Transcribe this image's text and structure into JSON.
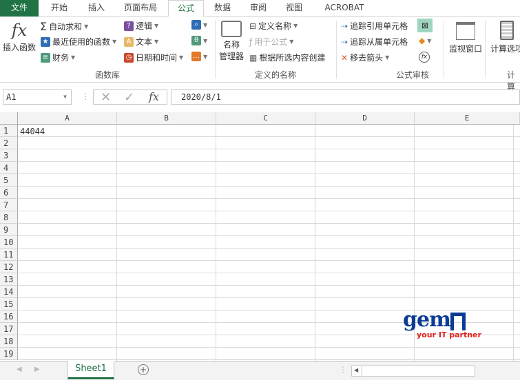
{
  "tabs": [
    "文件",
    "开始",
    "插入",
    "页面布局",
    "公式",
    "数据",
    "审阅",
    "视图",
    "ACROBAT"
  ],
  "ribbon": {
    "insert_function": "插入函数",
    "autosum": "自动求和",
    "recent": "最近使用的函数",
    "financial": "财务",
    "logical": "逻辑",
    "text": "文本",
    "datetime": "日期和时间",
    "group_library": "函数库",
    "name_manager_1": "名称",
    "name_manager_2": "管理器",
    "define_name": "定义名称",
    "use_in_formula": "用于公式",
    "create_from_selection": "根据所选内容创建",
    "group_names": "定义的名称",
    "trace_precedents": "追踪引用单元格",
    "trace_dependents": "追踪从属单元格",
    "remove_arrows": "移去箭头",
    "group_audit": "公式审核",
    "watch_window": "监视窗口",
    "calc_options": "计算选项",
    "group_calc": "计算"
  },
  "formula_bar": {
    "name_box": "A1",
    "fx": "fx",
    "value": "2020/8/1"
  },
  "columns": [
    "A",
    "B",
    "C",
    "D",
    "E"
  ],
  "rows": [
    "1",
    "2",
    "3",
    "4",
    "5",
    "6",
    "7",
    "8",
    "9",
    "10",
    "11",
    "12",
    "13",
    "14",
    "15",
    "16",
    "17",
    "18",
    "19"
  ],
  "cells": {
    "A1": "44044"
  },
  "sheet_tab": "Sheet1",
  "logo": {
    "name": "gemini",
    "tagline": "your IT partner"
  }
}
